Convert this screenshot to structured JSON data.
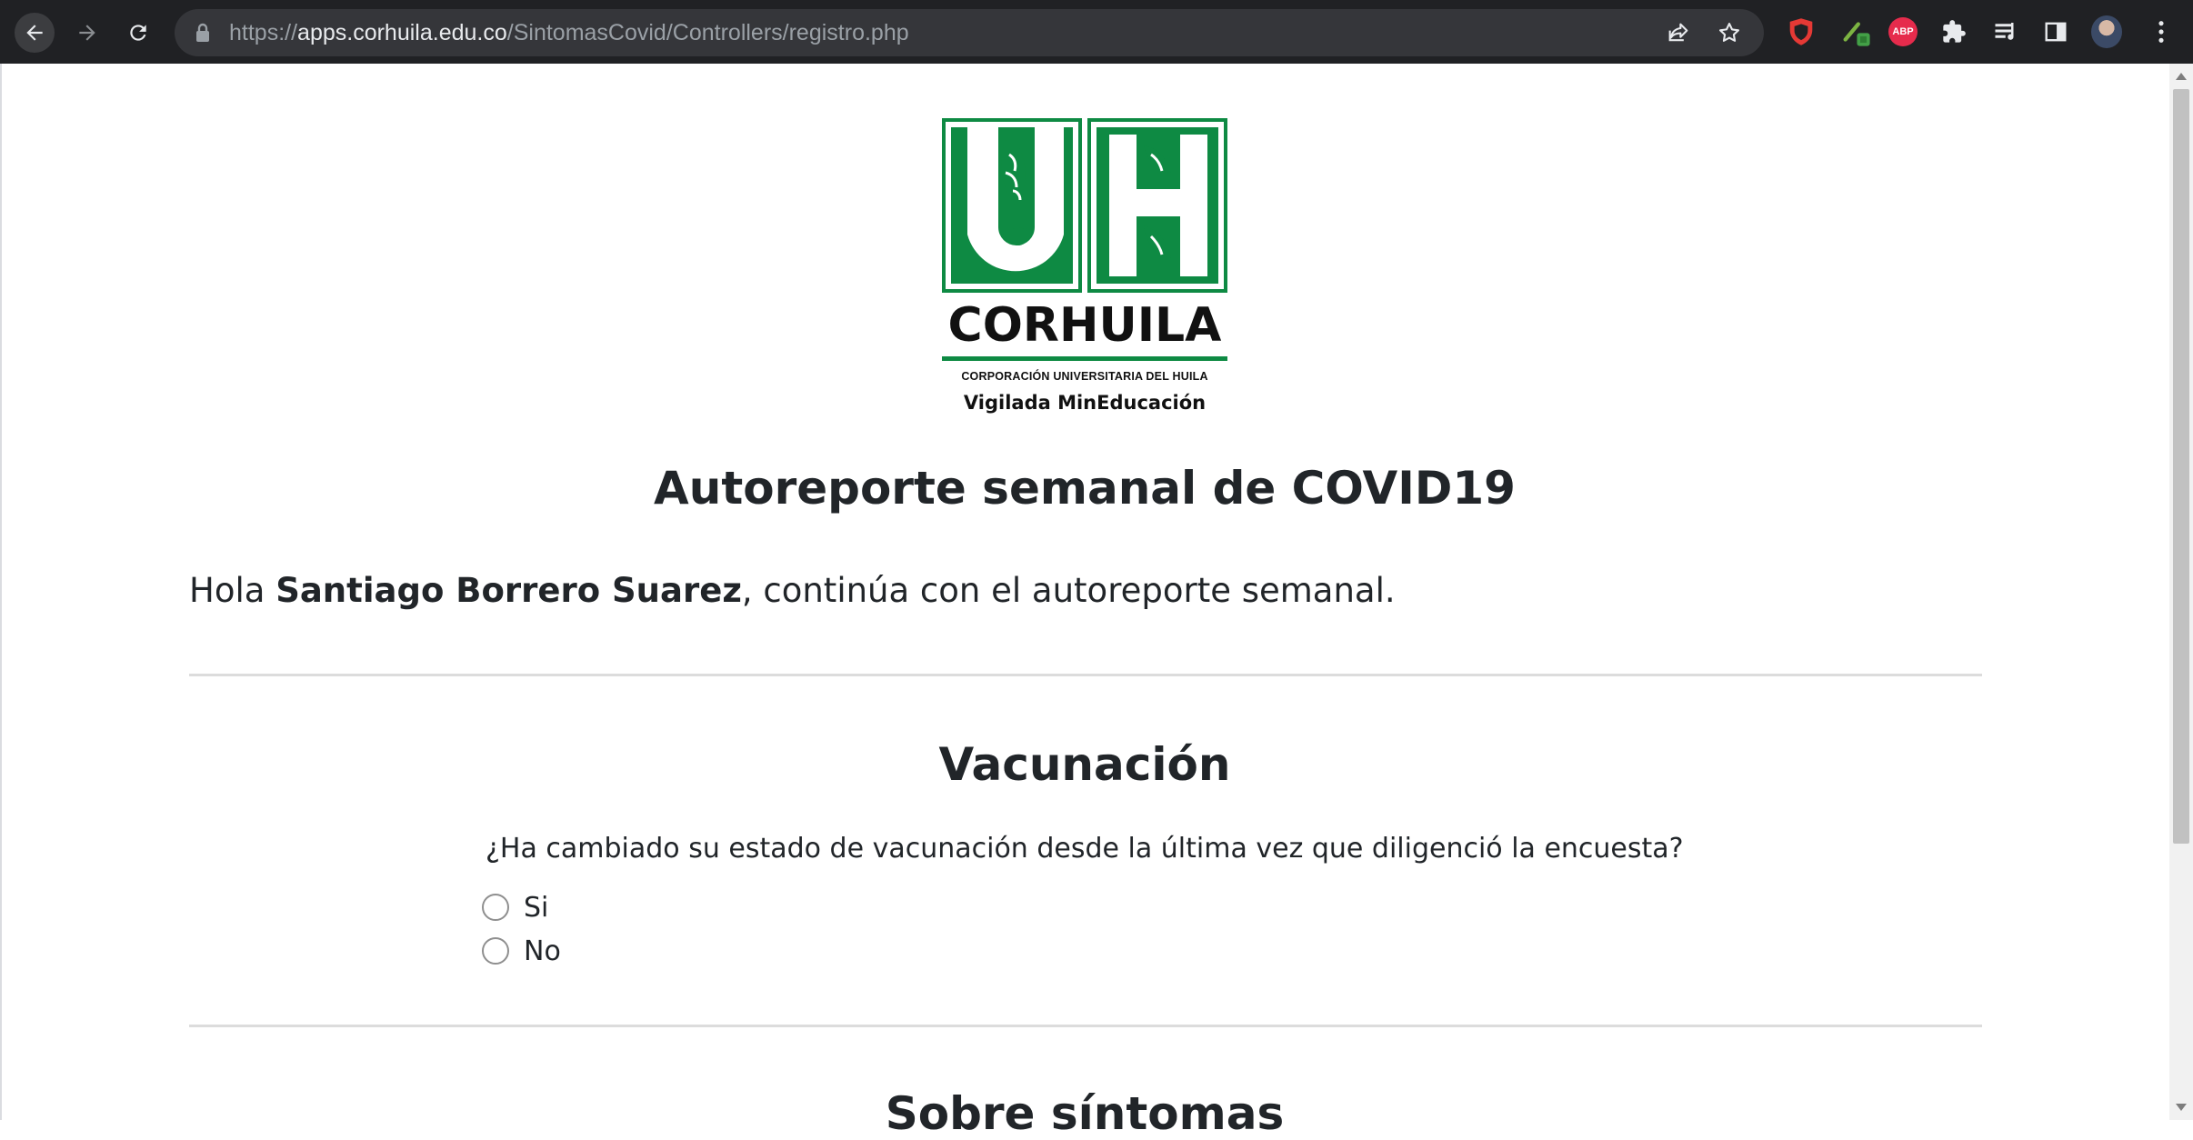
{
  "browser": {
    "url_scheme": "https://",
    "url_host": "apps.corhuila.edu.co",
    "url_path": "/SintomasCovid/Controllers/registro.php"
  },
  "logo": {
    "name": "CORHUILA",
    "subtitle": "CORPORACIÓN UNIVERSITARIA DEL HUILA",
    "tagline": "Vigilada MinEducación",
    "brand_color": "#0e8a43"
  },
  "page": {
    "title": "Autoreporte semanal de COVID19",
    "greeting_prefix": "Hola ",
    "user_name": "Santiago Borrero Suarez",
    "greeting_suffix": ", continúa con el autoreporte semanal."
  },
  "vacunacion": {
    "title": "Vacunación",
    "question": "¿Ha cambiado su estado de vacunación desde la última vez que diligenció la encuesta?",
    "options": [
      "Si",
      "No"
    ]
  },
  "sintomas": {
    "title": "Sobre síntomas"
  },
  "extensions": {
    "abp_label": "ABP"
  }
}
